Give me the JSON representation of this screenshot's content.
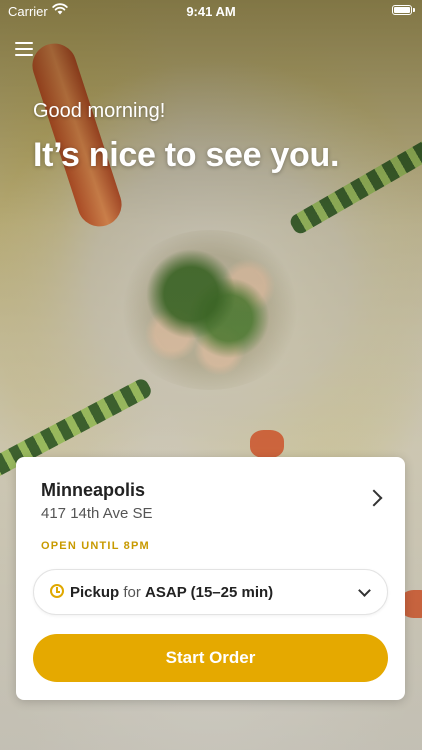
{
  "status_bar": {
    "carrier": "Carrier",
    "time": "9:41 AM"
  },
  "header": {
    "greeting": "Good morning!",
    "headline": "It’s nice to see you."
  },
  "location": {
    "name": "Minneapolis",
    "address": "417 14th Ave SE",
    "open_status": "OPEN UNTIL 8PM"
  },
  "pickup": {
    "mode": "Pickup",
    "connector": "for",
    "time": "ASAP (15–25 min)"
  },
  "actions": {
    "start_order": "Start Order"
  },
  "colors": {
    "accent": "#e5a900",
    "open_status": "#c89a00"
  }
}
